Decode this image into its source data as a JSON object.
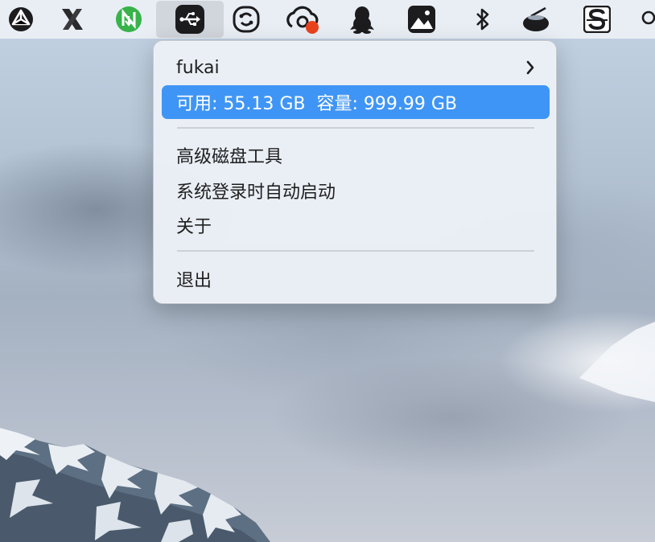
{
  "menubar": {
    "icons": [
      "triangle-logo-icon",
      "x-app-icon",
      "n-download-icon",
      "usb-drive-icon",
      "link-tool-icon",
      "cloud-sync-icon",
      "qq-penguin-icon",
      "image-viewer-icon",
      "bluetooth-icon",
      "flying-saucer-icon",
      "s-app-icon",
      "search-icon"
    ]
  },
  "menu": {
    "items": [
      {
        "label": "fukai",
        "has_submenu": true
      },
      {
        "label": "可用: 55.13 GB  容量: 999.99 GB",
        "highlighted": true
      },
      {
        "label": "高级磁盘工具"
      },
      {
        "label": "系统登录时自动启动"
      },
      {
        "label": "关于"
      },
      {
        "label": "退出"
      }
    ]
  },
  "colors": {
    "highlight": "#3f95f5",
    "status_red": "#e8431f"
  }
}
